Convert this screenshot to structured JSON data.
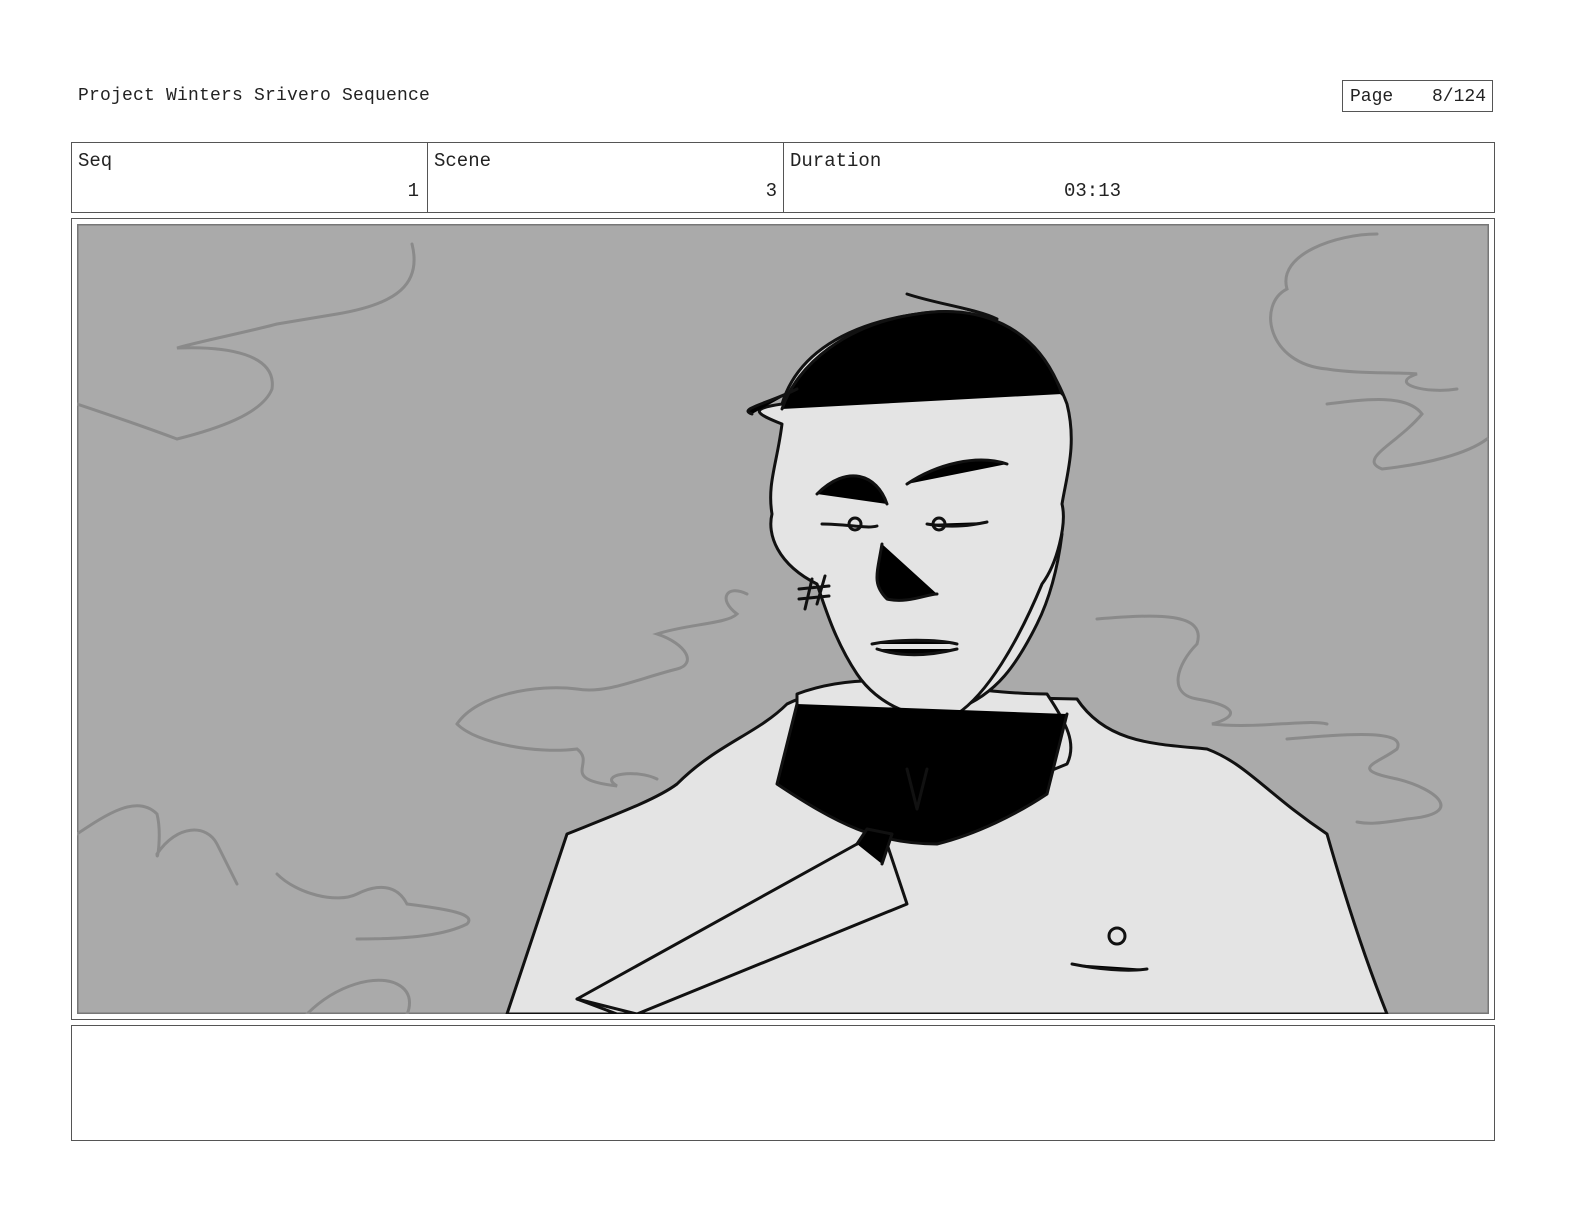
{
  "header": {
    "project_title": "Project Winters Srivero Sequence",
    "page_label": "Page",
    "page_number": "8/124"
  },
  "info": {
    "seq_label": "Seq",
    "seq_value": "1",
    "scene_label": "Scene",
    "scene_value": "3",
    "duration_label": "Duration",
    "duration_value": "03:13"
  },
  "notes": {
    "text": ""
  }
}
